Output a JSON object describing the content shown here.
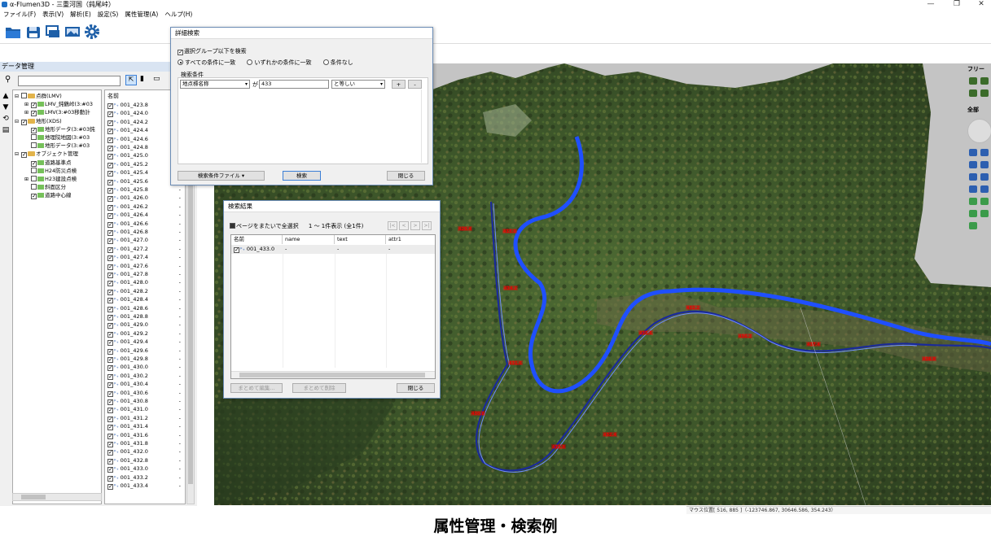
{
  "window": {
    "title": "α-Flumen3D - 三重河国（鈍尾峠）",
    "minimize": "—",
    "restore": "❐",
    "close": "✕"
  },
  "menu": [
    "ファイル(F)",
    "表示(V)",
    "解析(E)",
    "設定(S)",
    "属性管理(A)",
    "ヘルプ(H)"
  ],
  "toolbar": {
    "icons": [
      "folder-open-icon",
      "save-icon",
      "layer-tools-icon",
      "image-export-icon",
      "settings-gear-icon"
    ]
  },
  "data_panel": {
    "title": "データ管理",
    "tree": [
      {
        "label": "点群(LMV)",
        "level": 0,
        "expander": "⊟",
        "checked": false,
        "type": "folder"
      },
      {
        "label": "LMV_鈍鶴峠(3:#03",
        "level": 1,
        "expander": "⊞",
        "checked": true,
        "type": "leaf"
      },
      {
        "label": "LMV(3:#03移動計",
        "level": 1,
        "expander": "⊞",
        "checked": true,
        "type": "leaf"
      },
      {
        "label": "地形(XDS)",
        "level": 0,
        "expander": "⊟",
        "checked": true,
        "type": "folder"
      },
      {
        "label": "地形データ(3:#03鈍",
        "level": 1,
        "expander": "",
        "checked": true,
        "type": "leaf"
      },
      {
        "label": "地理院地図(3:#03",
        "level": 1,
        "expander": "",
        "checked": false,
        "type": "leaf"
      },
      {
        "label": "地形データ(3:#03",
        "level": 1,
        "expander": "",
        "checked": false,
        "type": "leaf"
      },
      {
        "label": "オブジェクト管理",
        "level": 0,
        "expander": "⊟",
        "checked": true,
        "type": "folder"
      },
      {
        "label": "道路基準点",
        "level": 1,
        "expander": "",
        "checked": true,
        "type": "leaf"
      },
      {
        "label": "H24防災点検",
        "level": 1,
        "expander": "",
        "checked": false,
        "type": "leaf"
      },
      {
        "label": "H23建設点検",
        "level": 1,
        "expander": "⊞",
        "checked": false,
        "type": "leaf"
      },
      {
        "label": "斜面区分",
        "level": 1,
        "expander": "",
        "checked": false,
        "type": "leaf"
      },
      {
        "label": "道路中心線",
        "level": 1,
        "expander": "",
        "checked": true,
        "type": "leaf"
      }
    ],
    "list_header": "名前",
    "list_items": [
      "001_423.8",
      "001_424.0",
      "001_424.2",
      "001_424.4",
      "001_424.6",
      "001_424.8",
      "001_425.0",
      "001_425.2",
      "001_425.4",
      "001_425.6",
      "001_425.8",
      "001_426.0",
      "001_426.2",
      "001_426.4",
      "001_426.6",
      "001_426.8",
      "001_427.0",
      "001_427.2",
      "001_427.4",
      "001_427.6",
      "001_427.8",
      "001_428.0",
      "001_428.2",
      "001_428.4",
      "001_428.6",
      "001_428.8",
      "001_429.0",
      "001_429.2",
      "001_429.4",
      "001_429.6",
      "001_429.8",
      "001_430.0",
      "001_430.2",
      "001_430.4",
      "001_430.6",
      "001_430.8",
      "001_431.0",
      "001_431.2",
      "001_431.4",
      "001_431.6",
      "001_431.8",
      "001_432.0",
      "001_432.8",
      "001_433.0",
      "001_433.2",
      "001_433.4"
    ],
    "list_value": "-",
    "side_icons": [
      "arrow-up-icon",
      "arrow-down-icon",
      "refresh-icon",
      "save-small-icon"
    ]
  },
  "detail_search": {
    "title": "詳細検索",
    "group_label": "選択グループ以下を検索",
    "radios": [
      "すべての条件に一致",
      "いずれかの条件に一致",
      "条件なし"
    ],
    "conditions_label": "検索条件",
    "field_select": "地点標名称",
    "connector": "が",
    "value": "433",
    "operator_select": "と等しい",
    "add_label": "+",
    "remove_label": "-",
    "file_button": "検索条件ファイル",
    "search_button": "検索",
    "close_button": "閉じる"
  },
  "search_results": {
    "title": "検索結果",
    "select_all": "ページをまたいで全選択",
    "count": "1 ～ 1件表示 (全1件)",
    "pager": [
      "|<",
      "<",
      ">",
      ">|"
    ],
    "headers": [
      "名前",
      "name",
      "text",
      "attr1"
    ],
    "rows": [
      [
        "001_433.0",
        "-",
        "-",
        "-"
      ]
    ],
    "edit_button": "まとめて編集...",
    "delete_button": "まとめて削除",
    "close_button": "閉じる"
  },
  "map_tags": [
    "433.0",
    "434.2",
    "431.6",
    "430.8",
    "432.4",
    "432.2",
    "435.6",
    "436.2",
    "437.4",
    "438.8",
    "433.8",
    "429.4"
  ],
  "right_panel": {
    "label": "フリー",
    "label2": "全部"
  },
  "status_bar": "マウス位置[ 516, 885 ]（-123746.867, 30646.586, 354.243）",
  "caption": "属性管理・検索例",
  "colors": {
    "road_blue": "#1f4fff",
    "road_dark": "#1a2a9a",
    "title_bg": "#d9e4f2",
    "dialog_border": "#6b8cb5"
  }
}
